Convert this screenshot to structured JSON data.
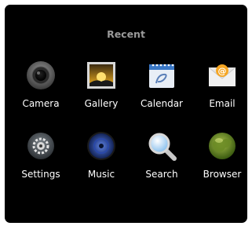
{
  "header": {
    "title": "Recent"
  },
  "apps": [
    {
      "label": "Camera",
      "icon": "camera-icon"
    },
    {
      "label": "Gallery",
      "icon": "gallery-icon"
    },
    {
      "label": "Calendar",
      "icon": "calendar-icon"
    },
    {
      "label": "Email",
      "icon": "email-icon"
    },
    {
      "label": "Settings",
      "icon": "settings-icon"
    },
    {
      "label": "Music",
      "icon": "music-icon"
    },
    {
      "label": "Search",
      "icon": "search-icon"
    },
    {
      "label": "Browser",
      "icon": "browser-icon"
    }
  ],
  "colors": {
    "background": "#000000",
    "header_text": "#9a9a9a",
    "label_text": "#ffffff"
  }
}
